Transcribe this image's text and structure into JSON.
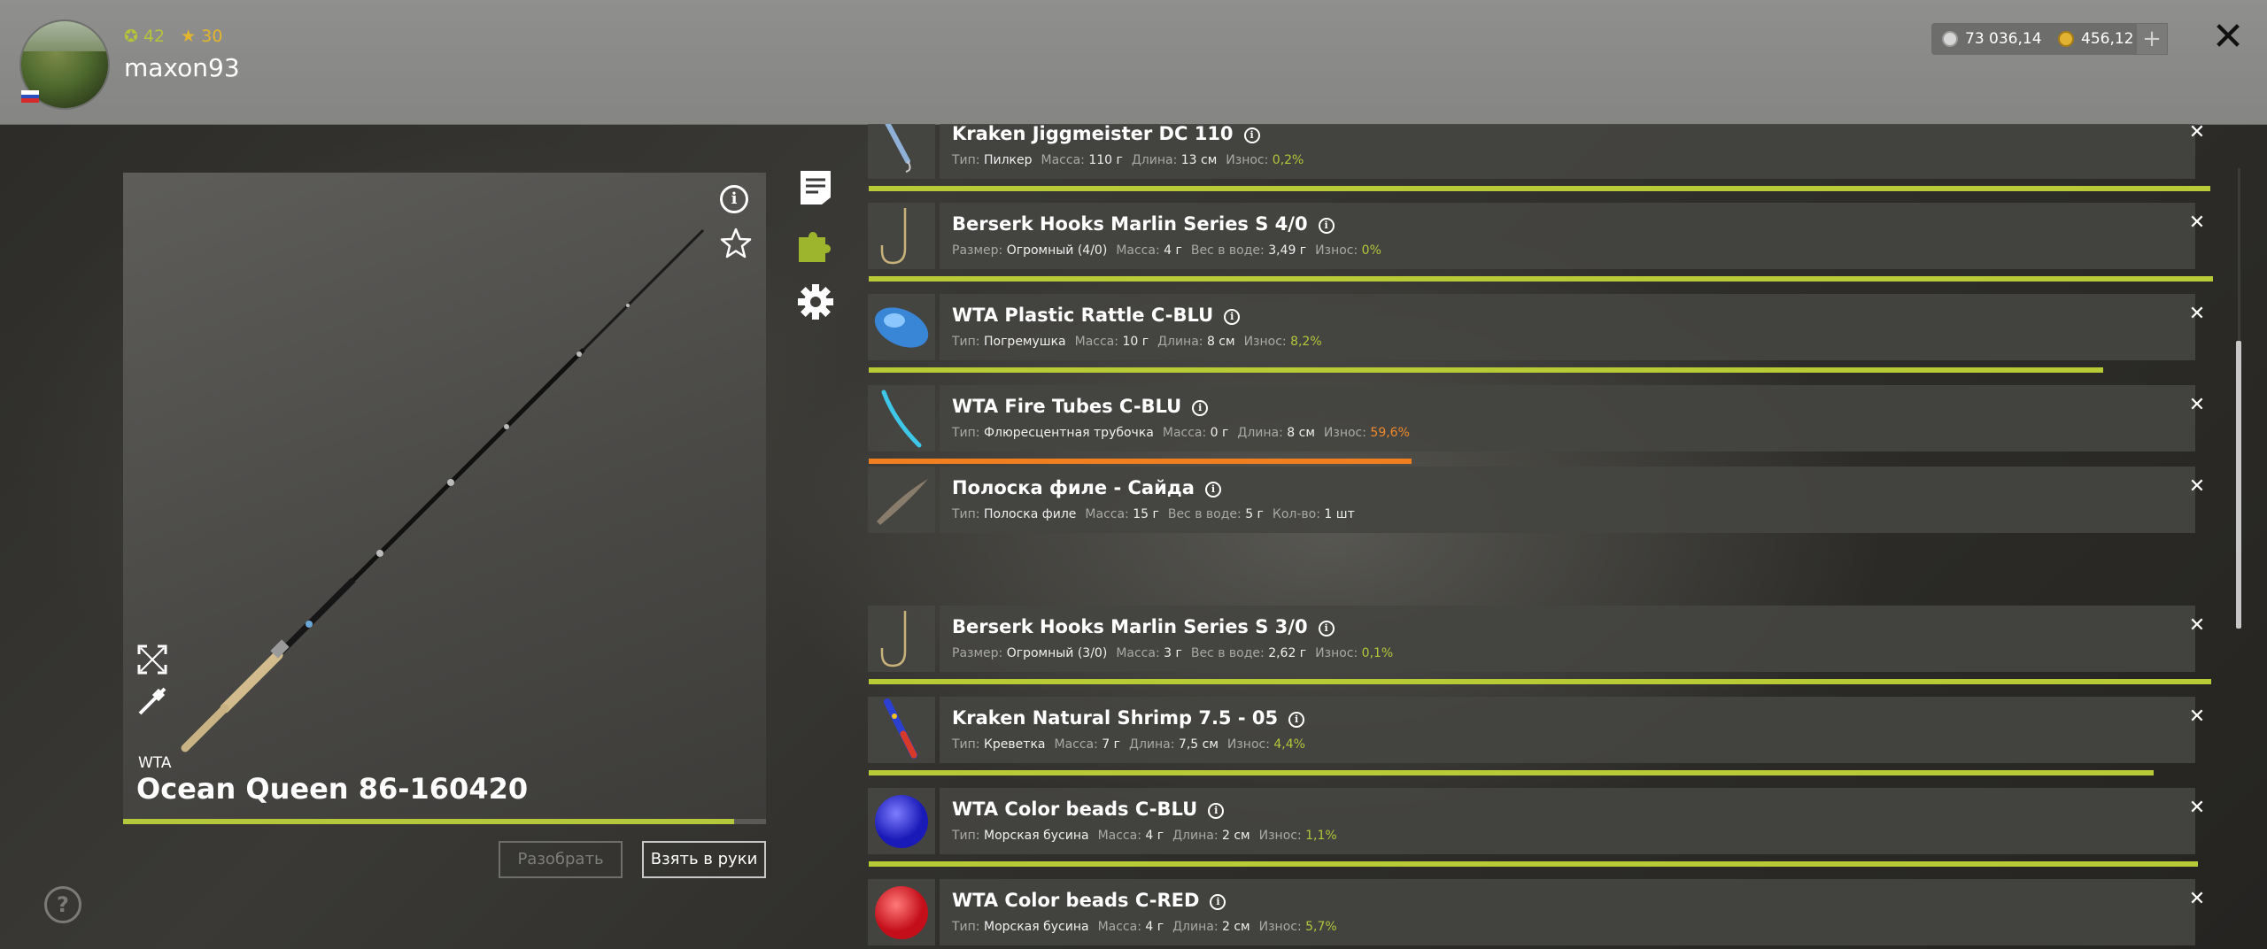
{
  "header": {
    "level": "42",
    "stars": "30",
    "username": "maxon93",
    "silver": "73 036,14",
    "gold": "456,12",
    "add_label": "+",
    "close_label": "✕"
  },
  "rod": {
    "brand": "WTA",
    "name": "Ocean Queen 86-160420",
    "wear_fraction": 0.95,
    "disassemble_label": "Разобрать",
    "take_label": "Взять в руки"
  },
  "help": "?",
  "items": [
    {
      "title": "Kraken Jiggmeister DC 110",
      "props": [
        {
          "k": "Тип:",
          "v": "Пилкер"
        },
        {
          "k": "Масса:",
          "v": "110 г"
        },
        {
          "k": "Длина:",
          "v": "13 см"
        },
        {
          "k": "Износ:",
          "v": "0,2%",
          "tone": "good"
        }
      ],
      "wear_fraction": 0.998
    },
    {
      "title": "Berserk Hooks Marlin Series S 4/0",
      "props": [
        {
          "k": "Размер:",
          "v": "Огромный (4/0)"
        },
        {
          "k": "Масса:",
          "v": "4 г"
        },
        {
          "k": "Вес в воде:",
          "v": "3,49 г"
        },
        {
          "k": "Износ:",
          "v": "0%",
          "tone": "good"
        }
      ],
      "wear_fraction": 1.0
    },
    {
      "title": "WTA Plastic Rattle C-BLU",
      "props": [
        {
          "k": "Тип:",
          "v": "Погремушка"
        },
        {
          "k": "Масса:",
          "v": "10 г"
        },
        {
          "k": "Длина:",
          "v": "8 см"
        },
        {
          "k": "Износ:",
          "v": "8,2%",
          "tone": "good"
        }
      ],
      "wear_fraction": 0.918
    },
    {
      "title": "WTA Fire Tubes C-BLU",
      "props": [
        {
          "k": "Тип:",
          "v": "Флюресцентная трубочка"
        },
        {
          "k": "Масса:",
          "v": "0 г"
        },
        {
          "k": "Длина:",
          "v": "8 см"
        },
        {
          "k": "Износ:",
          "v": "59,6%",
          "tone": "warn"
        }
      ],
      "wear_fraction": 0.404
    },
    {
      "title": "Полоска филе - Сайда",
      "props": [
        {
          "k": "Тип:",
          "v": "Полоска филе"
        },
        {
          "k": "Масса:",
          "v": "15 г"
        },
        {
          "k": "Вес в воде:",
          "v": "5 г"
        },
        {
          "k": "Кол-во:",
          "v": "1 шт"
        }
      ]
    },
    {
      "title": "Berserk Hooks Marlin Series S 3/0",
      "props": [
        {
          "k": "Размер:",
          "v": "Огромный (3/0)"
        },
        {
          "k": "Масса:",
          "v": "3 г"
        },
        {
          "k": "Вес в воде:",
          "v": "2,62 г"
        },
        {
          "k": "Износ:",
          "v": "0,1%",
          "tone": "good"
        }
      ],
      "wear_fraction": 0.999
    },
    {
      "title": "Kraken Natural Shrimp 7.5 - 05",
      "props": [
        {
          "k": "Тип:",
          "v": "Креветка"
        },
        {
          "k": "Масса:",
          "v": "7 г"
        },
        {
          "k": "Длина:",
          "v": "7,5 см"
        },
        {
          "k": "Износ:",
          "v": "4,4%",
          "tone": "good"
        }
      ],
      "wear_fraction": 0.956
    },
    {
      "title": "WTA Color beads C-BLU",
      "props": [
        {
          "k": "Тип:",
          "v": "Морская бусина"
        },
        {
          "k": "Масса:",
          "v": "4 г"
        },
        {
          "k": "Длина:",
          "v": "2 см"
        },
        {
          "k": "Износ:",
          "v": "1,1%",
          "tone": "good"
        }
      ],
      "wear_fraction": 0.989
    },
    {
      "title": "WTA Color beads C-RED",
      "props": [
        {
          "k": "Тип:",
          "v": "Морская бусина"
        },
        {
          "k": "Масса:",
          "v": "4 г"
        },
        {
          "k": "Длина:",
          "v": "2 см"
        },
        {
          "k": "Износ:",
          "v": "5,7%",
          "tone": "good"
        }
      ]
    }
  ],
  "icons": {
    "thumbs": [
      "jig-lure-icon",
      "hook-icon",
      "rattle-icon",
      "fire-tube-icon",
      "fish-fillet-icon",
      "hook-icon",
      "shrimp-lure-icon",
      "blue-bead-icon",
      "red-bead-icon"
    ]
  }
}
